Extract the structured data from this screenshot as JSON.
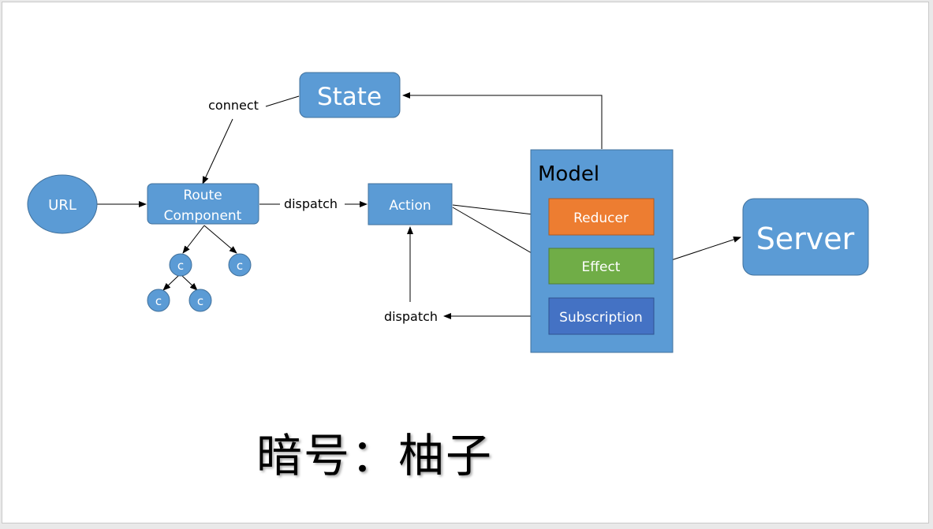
{
  "diagram": {
    "state": "State",
    "url": "URL",
    "route_component": [
      "Route",
      "Component"
    ],
    "child_node": "c",
    "action": "Action",
    "model": "Model",
    "reducer": "Reducer",
    "effect": "Effect",
    "subscription": "Subscription",
    "server": "Server",
    "edge_connect": "connect",
    "edge_dispatch_route_action": "dispatch",
    "edge_dispatch_subscription": "dispatch"
  },
  "caption": "暗号：柚子",
  "colors": {
    "node_fill": "#5b9bd5",
    "node_stroke": "#41719c",
    "reducer_fill": "#ed7d31",
    "effect_fill": "#70ad47",
    "subscription_fill": "#4472c4",
    "arrow": "#000000"
  }
}
